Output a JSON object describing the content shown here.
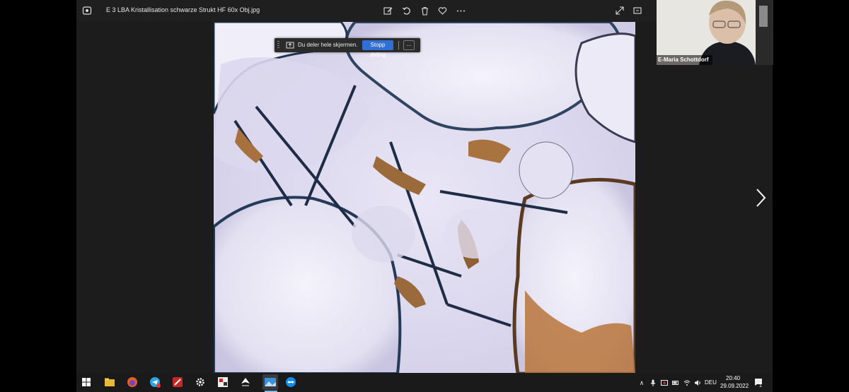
{
  "window": {
    "title": "E 3 LBA Kristallisation schwarze Strukt HF 60x Obj.jpg"
  },
  "toolbar": {
    "icons": [
      "edit-image-icon",
      "rotate-icon",
      "delete-icon",
      "favorite-icon",
      "more-icon"
    ],
    "right_icons": [
      "expand-icon",
      "fit-icon"
    ]
  },
  "share_bar": {
    "text": "Du deler hele skjermen.",
    "stop_label": "Stopp deling",
    "more_label": "..."
  },
  "video": {
    "participant_name": "E-Maria Schottdorf"
  },
  "taskbar": {
    "apps": [
      "windows-start-icon",
      "file-explorer-icon",
      "firefox-icon",
      "telegram-icon",
      "app-red-icon",
      "settings-icon",
      "app-media-icon",
      "app-nav-icon",
      "photos-icon",
      "teamviewer-icon"
    ],
    "language": "DEU",
    "time": "20:40",
    "date": "29.09.2022",
    "notification_count": "1"
  },
  "colors": {
    "accent": "#2f6fd6",
    "taskbar_bg": "#1a1a1a"
  }
}
